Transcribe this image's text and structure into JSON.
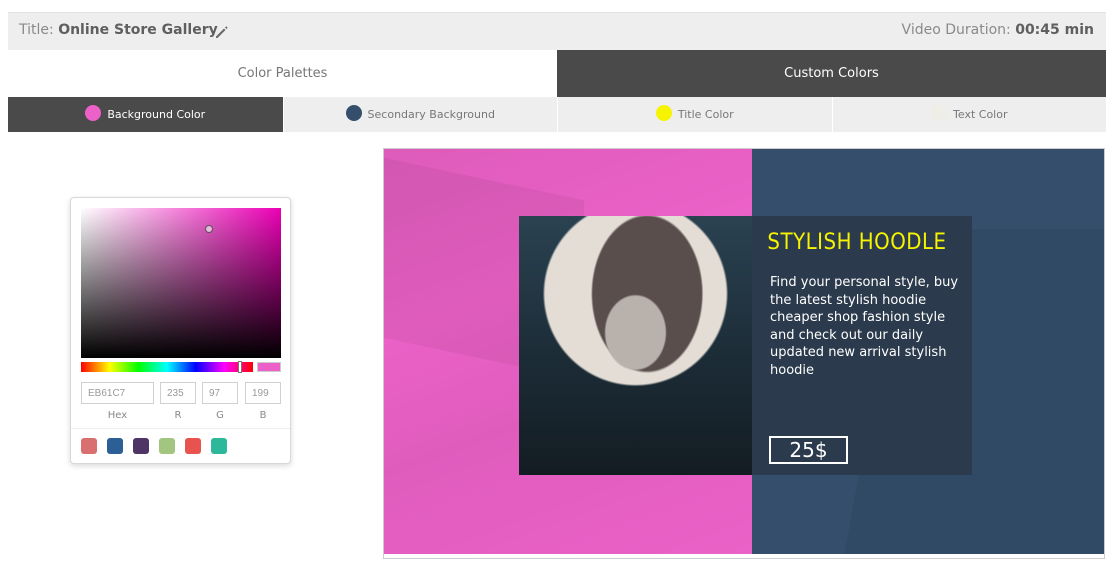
{
  "header": {
    "title_label": "Title:",
    "title_value": "Online Store Gallery",
    "duration_label": "Video Duration:",
    "duration_value": "00:45 min"
  },
  "main_tabs": [
    {
      "label": "Color Palettes",
      "active": false
    },
    {
      "label": "Custom Colors",
      "active": true
    }
  ],
  "color_tabs": [
    {
      "label": "Background Color",
      "color": "#EB61C7",
      "active": true
    },
    {
      "label": "Secondary Background",
      "color": "#344E6B",
      "active": false
    },
    {
      "label": "Title Color",
      "color": "#F6F400",
      "active": false
    },
    {
      "label": "Text Color",
      "color": "#EEEEE6",
      "active": false
    }
  ],
  "picker": {
    "hex": "EB61C7",
    "r": "235",
    "g": "97",
    "b": "199",
    "labels": {
      "hex": "Hex",
      "r": "R",
      "g": "G",
      "b": "B"
    },
    "current_color": "#EB61C7",
    "swatches": [
      "#D87070",
      "#2C5F95",
      "#4E3566",
      "#A2C67F",
      "#E8524F",
      "#2EB89B"
    ]
  },
  "preview": {
    "background": "#EB61C7",
    "secondary": "#344E6B",
    "title": "STYLISH HOODLE",
    "text": "Find your  personal style, buy the latest stylish hoodie cheaper shop fashion style and check out our daily updated new arrival stylish hoodie",
    "price": "25$"
  }
}
